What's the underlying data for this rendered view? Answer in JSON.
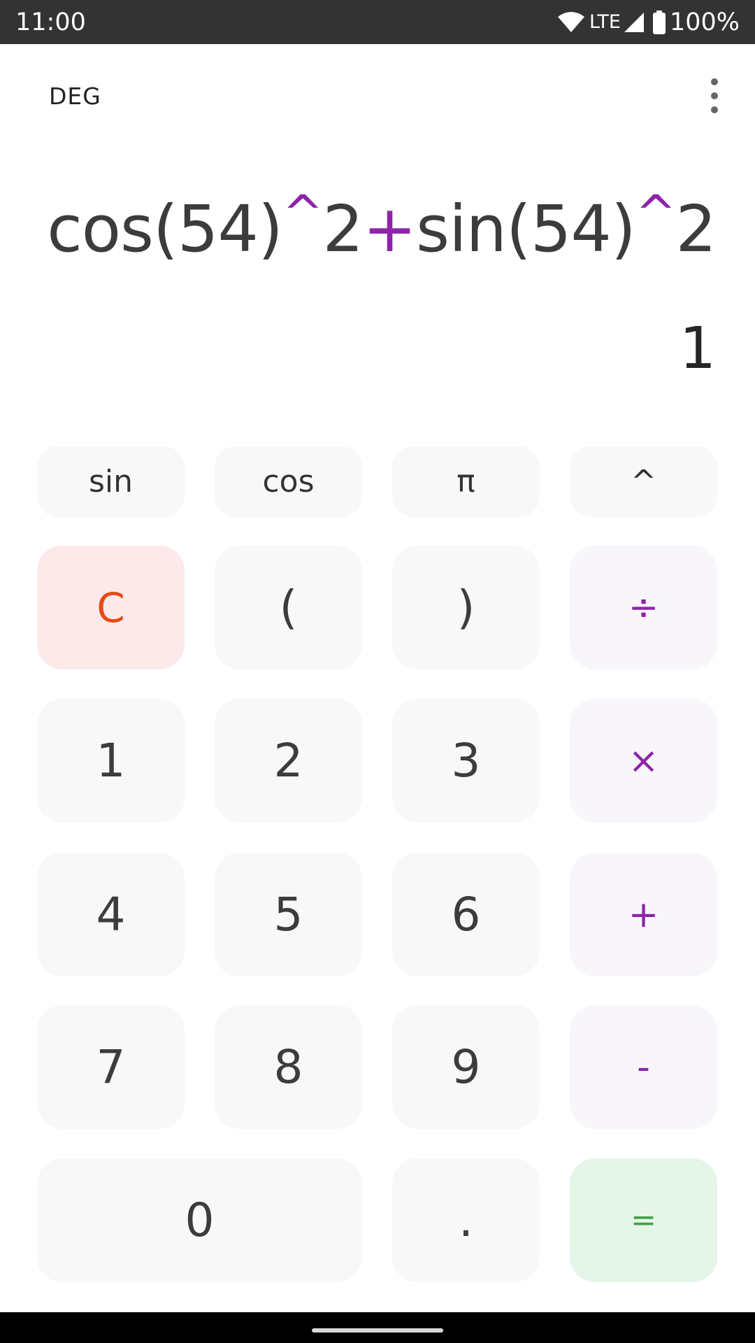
{
  "status_bar": {
    "time": "11:00",
    "network": "LTE",
    "battery": "100%",
    "icons": [
      "wifi-icon",
      "signal-icon",
      "battery-icon"
    ]
  },
  "toolbar": {
    "mode_label": "DEG",
    "menu_icon": "more-vert-icon"
  },
  "display": {
    "expression_parts": [
      "cos(54)",
      "^",
      "2",
      "+",
      "sin(54)",
      "^",
      "2"
    ],
    "result": "1"
  },
  "keys": {
    "sin": "sin",
    "cos": "cos",
    "pi": "π",
    "power": "^",
    "clear": "C",
    "open_paren": "(",
    "close_paren": ")",
    "divide": "÷",
    "one": "1",
    "two": "2",
    "three": "3",
    "multiply": "×",
    "four": "4",
    "five": "5",
    "six": "6",
    "plus": "+",
    "seven": "7",
    "eight": "8",
    "nine": "9",
    "minus": "-",
    "zero": "0",
    "decimal": ".",
    "equals": "="
  },
  "colors": {
    "operator": "#8e24aa",
    "clear": "#e64a19",
    "equals": "#43a047",
    "status_bar_bg": "#333333"
  }
}
